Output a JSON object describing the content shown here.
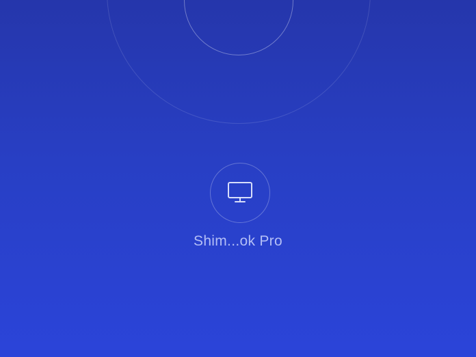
{
  "colors": {
    "background_top": "#2536ab",
    "background_bottom": "#2b44d9",
    "ring_color": "#ffffff"
  },
  "local_device": {
    "icon": "monitor-icon"
  },
  "discovered_devices": [
    {
      "icon": "monitor-icon",
      "name": "Shim...ok Pro"
    }
  ]
}
